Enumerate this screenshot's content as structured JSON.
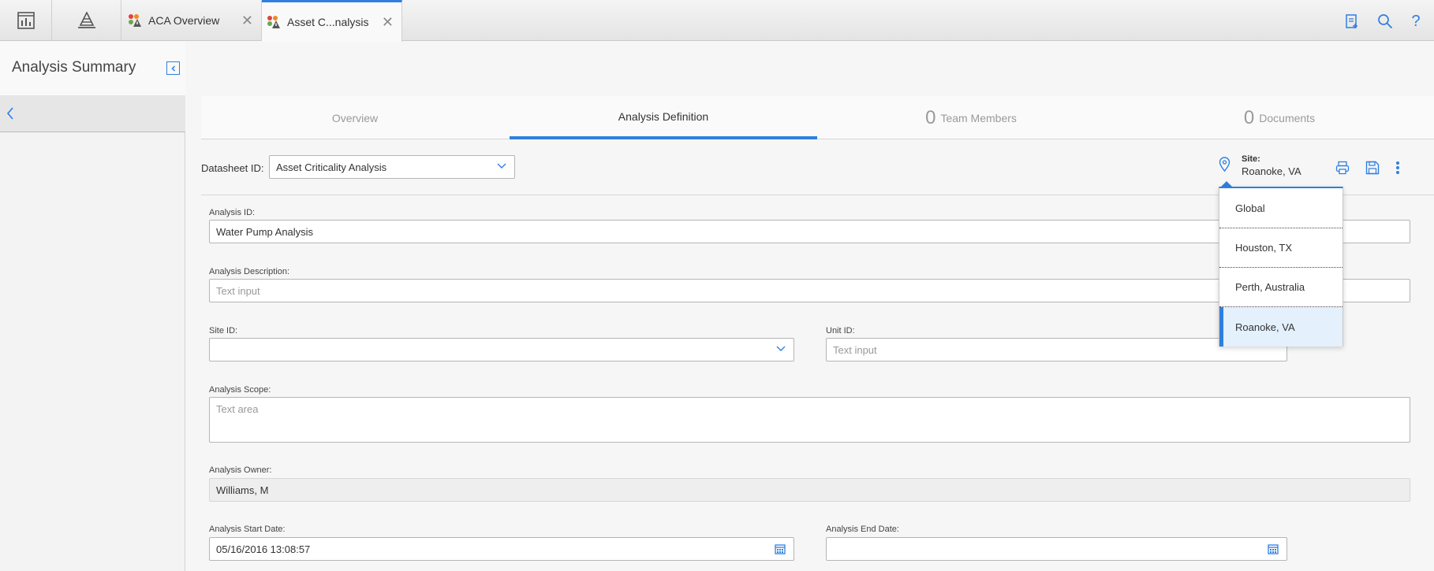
{
  "topbar": {
    "tabs": [
      {
        "label": "ACA Overview",
        "icon": "aca-app-icon"
      },
      {
        "label": "Asset C...nalysis",
        "icon": "aca-app-icon"
      }
    ],
    "right_icons": [
      "clipboard-add-icon",
      "search-icon",
      "help-icon"
    ],
    "help_glyph": "?"
  },
  "left_panel": {
    "title": "Analysis Summary"
  },
  "main_tabs": [
    {
      "label": "Overview",
      "count": ""
    },
    {
      "label": "Analysis Definition",
      "count": ""
    },
    {
      "label": "Team Members",
      "count": "0"
    },
    {
      "label": "Documents",
      "count": "0"
    }
  ],
  "toolbar": {
    "datasheet_label": "Datasheet ID:",
    "datasheet_value": "Asset Criticality Analysis",
    "site_label": "Site:",
    "site_value": "Roanoke, VA"
  },
  "site_dropdown": {
    "options": [
      "Global",
      "Houston, TX",
      "Perth, Australia",
      "Roanoke, VA"
    ],
    "selected": "Roanoke, VA"
  },
  "form": {
    "analysis_id": {
      "label": "Analysis ID:",
      "value": "Water Pump Analysis"
    },
    "analysis_description": {
      "label": "Analysis Description:",
      "placeholder": "Text input"
    },
    "site_id": {
      "label": "Site ID:",
      "value": ""
    },
    "unit_id": {
      "label": "Unit ID:",
      "placeholder": "Text input"
    },
    "analysis_scope": {
      "label": "Analysis Scope:",
      "placeholder": "Text area"
    },
    "analysis_owner": {
      "label": "Analysis Owner:",
      "value": "Williams, M"
    },
    "start_date": {
      "label": "Analysis Start Date:",
      "value": "05/16/2016 13:08:57"
    },
    "end_date": {
      "label": "Analysis End Date:",
      "value": ""
    }
  },
  "colors": {
    "accent": "#2f7fe0"
  }
}
